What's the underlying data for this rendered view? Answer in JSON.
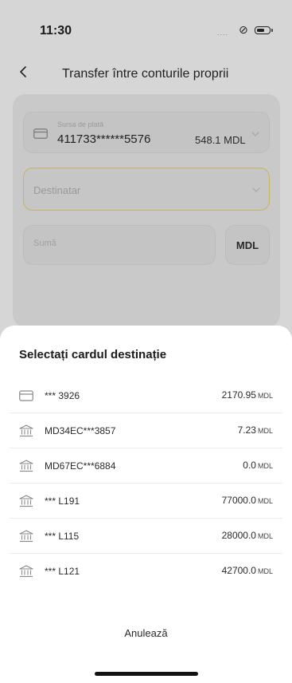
{
  "status_bar": {
    "time": "11:30",
    "signal": "....",
    "link_icon": "link-icon",
    "battery_icon": "battery-icon"
  },
  "header": {
    "title": "Transfer între conturile proprii",
    "back_icon": "chevron-left-icon"
  },
  "form": {
    "source": {
      "label": "Sursa de plată",
      "card_number": "411733******5576",
      "balance": "548.1 MDL",
      "icon": "credit-card-icon"
    },
    "destination": {
      "placeholder": "Destinatar"
    },
    "amount": {
      "placeholder": "Sumă"
    },
    "currency": "MDL"
  },
  "sheet": {
    "title": "Selectați cardul destinație",
    "items": [
      {
        "icon": "credit-card-icon",
        "label": "*** 3926",
        "amount": "2170.95",
        "currency": "MDL"
      },
      {
        "icon": "bank-icon",
        "label": "MD34EC***3857",
        "amount": "7.23",
        "currency": "MDL"
      },
      {
        "icon": "bank-icon",
        "label": "MD67EC***6884",
        "amount": "0.0",
        "currency": "MDL"
      },
      {
        "icon": "bank-icon",
        "label": "*** L191",
        "amount": "77000.0",
        "currency": "MDL"
      },
      {
        "icon": "bank-icon",
        "label": "*** L115",
        "amount": "28000.0",
        "currency": "MDL"
      },
      {
        "icon": "bank-icon",
        "label": "*** L121",
        "amount": "42700.0",
        "currency": "MDL"
      }
    ],
    "cancel_label": "Anulează"
  },
  "colors": {
    "overlay": "#d6d6d6",
    "sheet": "#ffffff",
    "destination_border": "#c9b266"
  }
}
